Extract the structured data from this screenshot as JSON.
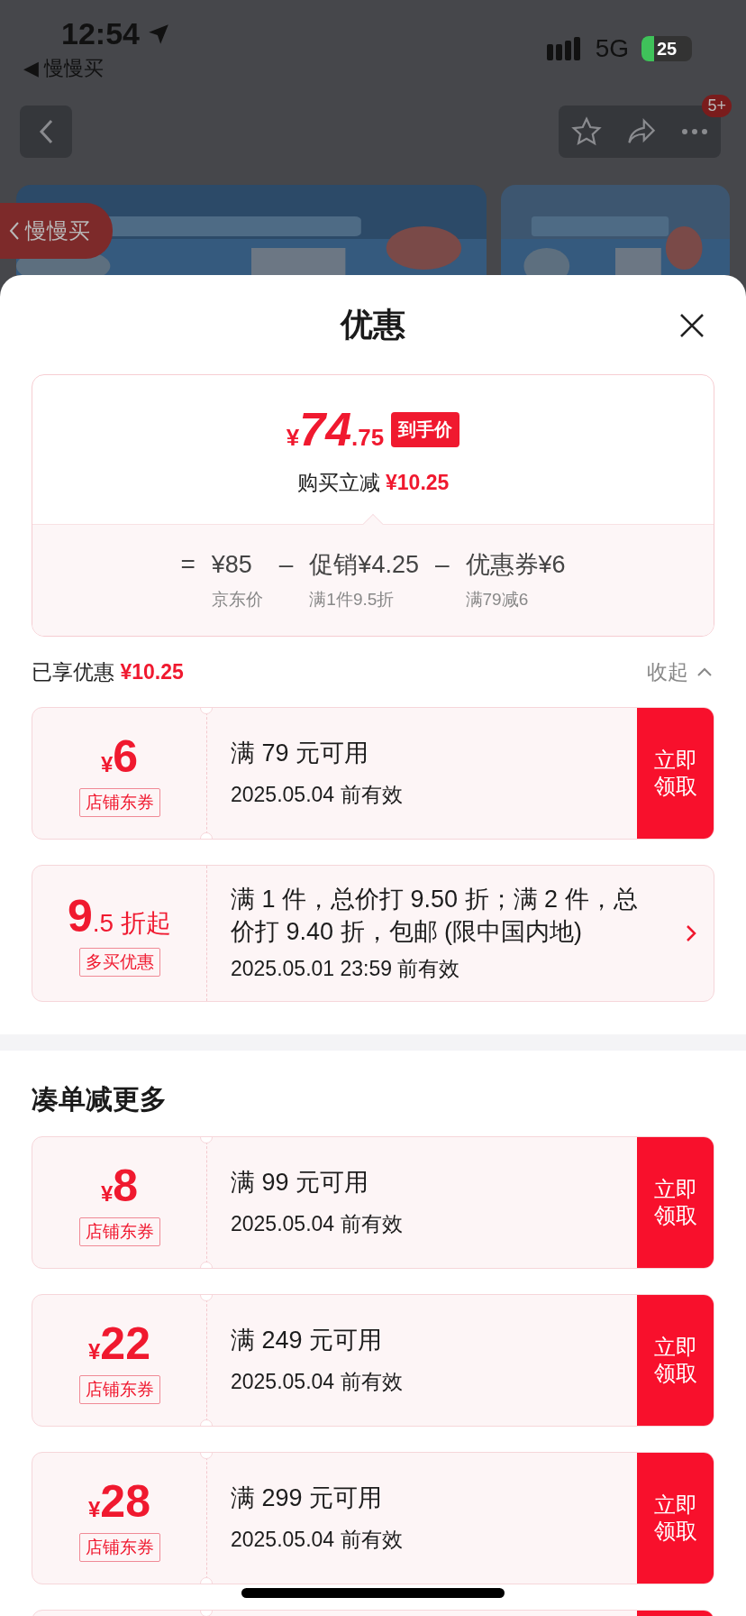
{
  "status_bar": {
    "time": "12:54",
    "back_app": "◀ 慢慢买",
    "network": "5G",
    "battery": "25"
  },
  "nav": {
    "badge": "5+"
  },
  "floating_tag": {
    "label": "慢慢买"
  },
  "sheet": {
    "title": "优惠",
    "price": {
      "currency": "¥",
      "integer": "74",
      "decimal": ".75",
      "tag": "到手价",
      "saving_label": "购买立减",
      "saving": "¥10.25"
    },
    "breakdown": [
      {
        "op": "=",
        "value": "¥85",
        "note": "京东价"
      },
      {
        "op": "–",
        "value": "促销¥4.25",
        "note": "满1件9.5折"
      },
      {
        "op": "–",
        "value": "优惠券¥6",
        "note": "满79减6"
      }
    ],
    "enjoyed": {
      "label": "已享优惠",
      "amount": "¥10.25",
      "toggle": "收起"
    },
    "coupons": [
      {
        "kind": "coupon",
        "currency": "¥",
        "amount": "6",
        "tag": "店铺东券",
        "condition": "满 79 元可用",
        "expiry": "2025.05.04 前有效",
        "action": "立即领取"
      },
      {
        "kind": "discount",
        "amount": "9",
        "suffix": ".5 折起",
        "tag": "多买优惠",
        "condition": "满 1 件，总价打 9.50 折；满 2 件，总价打 9.40 折，包邮 (限中国内地)",
        "expiry": "2025.05.01 23:59 前有效"
      }
    ],
    "more_title": "凑单减更多",
    "more_coupons": [
      {
        "kind": "coupon",
        "currency": "¥",
        "amount": "8",
        "tag": "店铺东券",
        "condition": "满 99 元可用",
        "expiry": "2025.05.04 前有效",
        "action": "立即领取"
      },
      {
        "kind": "coupon",
        "currency": "¥",
        "amount": "22",
        "tag": "店铺东券",
        "condition": "满 249 元可用",
        "expiry": "2025.05.04 前有效",
        "action": "立即领取"
      },
      {
        "kind": "coupon",
        "currency": "¥",
        "amount": "28",
        "tag": "店铺东券",
        "condition": "满 299 元可用",
        "expiry": "2025.05.04 前有效",
        "action": "立即领取"
      },
      {
        "kind": "cut"
      }
    ]
  }
}
